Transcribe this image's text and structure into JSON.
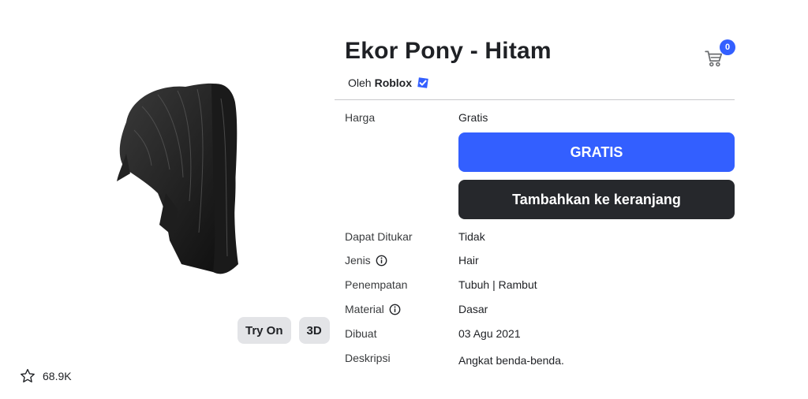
{
  "item": {
    "title": "Ekor Pony - Hitam",
    "by_prefix": "Oleh",
    "creator": "Roblox"
  },
  "cart": {
    "count": "0",
    "icon": "cart-icon"
  },
  "thumbnail": {
    "try_on_label": "Try On",
    "three_d_label": "3D"
  },
  "favorites": {
    "count": "68.9K",
    "icon": "star-icon"
  },
  "details": {
    "price_label": "Harga",
    "price_value": "Gratis",
    "buy_button": "GRATIS",
    "add_to_cart_button": "Tambahkan ke keranjang",
    "tradable_label": "Dapat Ditukar",
    "tradable_value": "Tidak",
    "type_label": "Jenis",
    "type_value": "Hair",
    "placement_label": "Penempatan",
    "placement_value": "Tubuh | Rambut",
    "material_label": "Material",
    "material_value": "Dasar",
    "created_label": "Dibuat",
    "created_value": "03 Agu 2021",
    "description_label": "Deskripsi",
    "description_value": "Angkat benda-benda."
  },
  "colors": {
    "primary_button": "#335fff",
    "dark_button": "#26282c",
    "badge": "#335fff",
    "verified": "#335fff"
  }
}
